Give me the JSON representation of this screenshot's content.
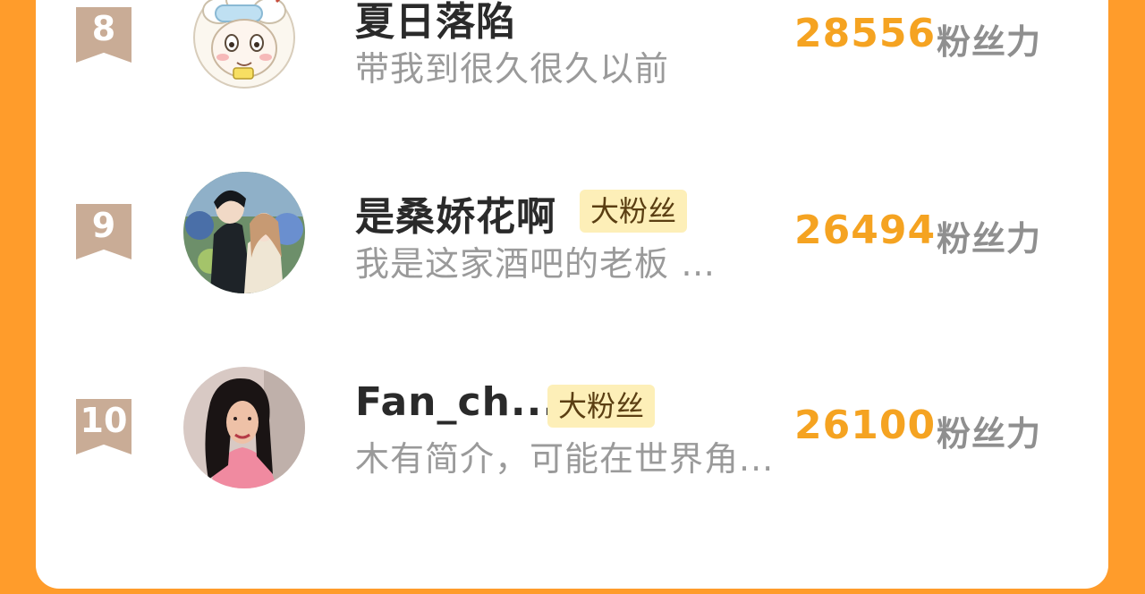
{
  "ranking": [
    {
      "rank": "8",
      "name": "夏日落陷",
      "badge": "",
      "bio": "带我到很久很久以前",
      "score": "28556",
      "unit": "粉丝力",
      "avatar": "cartoon-sheep-avatar"
    },
    {
      "rank": "9",
      "name": "是桑娇花啊",
      "badge": "大粉丝",
      "bio": "我是这家酒吧的老板 …",
      "score": "26494",
      "unit": "粉丝力",
      "avatar": "illustrated-couple-avatar"
    },
    {
      "rank": "10",
      "name": "Fan_ch...",
      "badge": "大粉丝",
      "bio": "木有简介，可能在世界角...",
      "score": "26100",
      "unit": "粉丝力",
      "avatar": "woman-photo-avatar"
    }
  ],
  "colors": {
    "background": "#FF9C2B",
    "score": "#F5A321",
    "rank_ribbon": "#C9AC96",
    "badge": "#FDEFB8"
  }
}
